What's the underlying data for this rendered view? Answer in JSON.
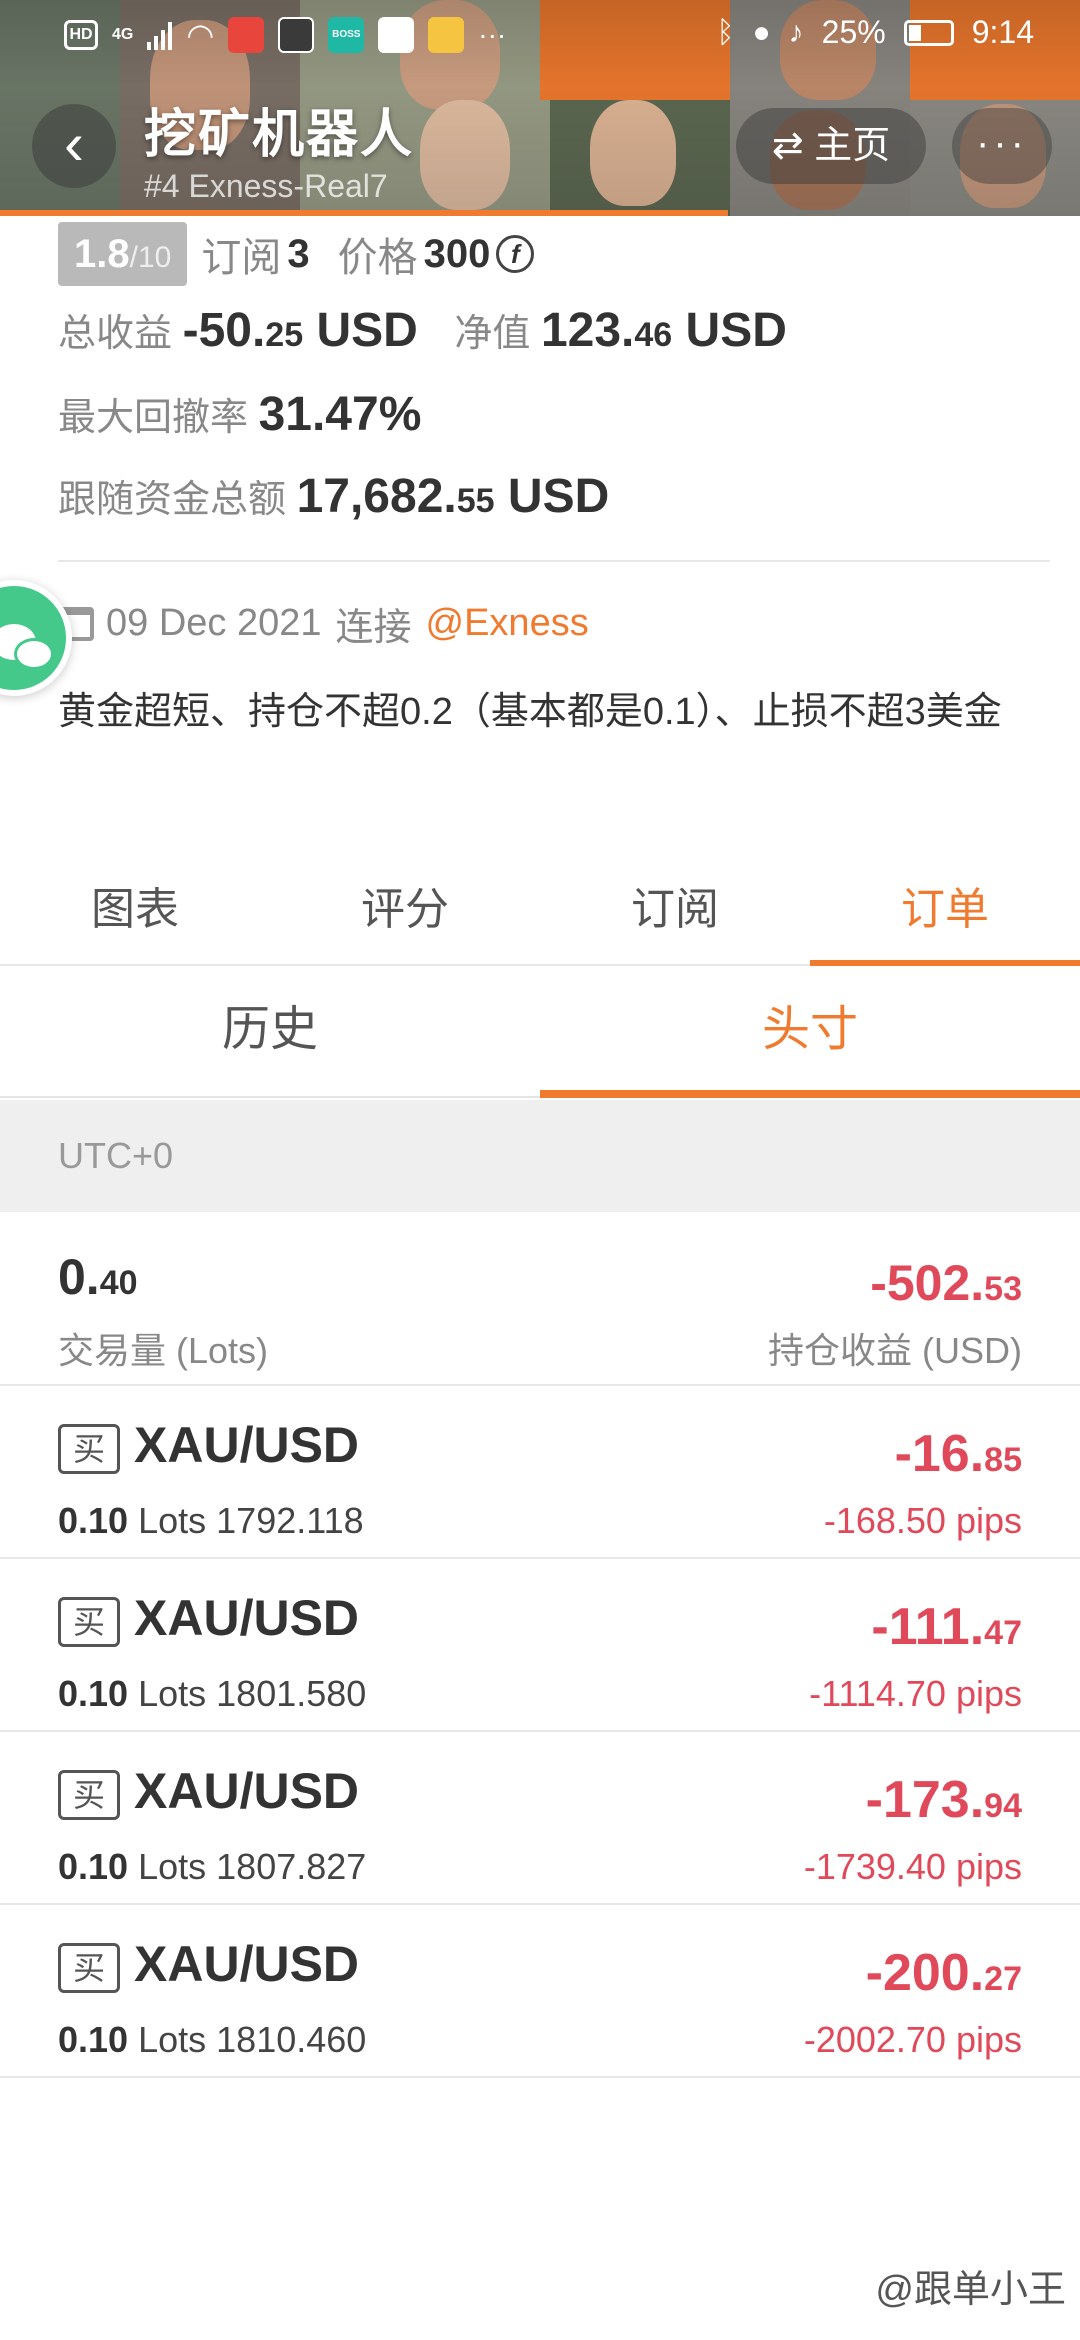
{
  "status_bar": {
    "network": "4G",
    "more": "···",
    "battery": "25%",
    "time": "9:14"
  },
  "header": {
    "title": "挖矿机器人",
    "subtitle": "#4   Exness-Real7",
    "back_icon": "chevron-left-icon",
    "home_label": "主页",
    "more_label": "···"
  },
  "stats": {
    "rating_value": "1.8",
    "rating_denominator": "/10",
    "subscriptions_label": "订阅",
    "subscriptions_value": "3",
    "price_label": "价格",
    "price_value": "300",
    "price_unit_symbol": "f",
    "total_profit_label": "总收益",
    "total_profit_int": "-50.",
    "total_profit_dec": "25",
    "total_profit_unit": "USD",
    "equity_label": "净值",
    "equity_int": "123.",
    "equity_dec": "46",
    "equity_unit": "USD",
    "max_drawdown_label": "最大回撤率",
    "max_drawdown_value": "31.47%",
    "follow_funds_label": "跟随资金总额",
    "follow_funds_int": "17,682.",
    "follow_funds_dec": "55",
    "follow_funds_unit": "USD"
  },
  "connection": {
    "date": "09 Dec 2021",
    "connect_label": "连接",
    "broker": "@Exness",
    "description": "黄金超短、持仓不超0.2（基本都是0.1）、止损不超3美金"
  },
  "tabs": [
    "图表",
    "评分",
    "订阅",
    "订单"
  ],
  "active_tab": "订单",
  "subtabs": [
    "历史",
    "头寸"
  ],
  "active_subtab": "头寸",
  "timezone": "UTC+0",
  "summary": {
    "volume_int": "0.",
    "volume_dec": "40",
    "volume_label": "交易量 (Lots)",
    "pl_int": "-502.",
    "pl_dec": "53",
    "pl_label": "持仓收益 (USD)"
  },
  "positions": [
    {
      "side": "买",
      "symbol": "XAU/USD",
      "lots": "0.10",
      "lots_unit": "Lots",
      "price": "1792.118",
      "pl_int": "-16.",
      "pl_dec": "85",
      "pips": "-168.50 pips"
    },
    {
      "side": "买",
      "symbol": "XAU/USD",
      "lots": "0.10",
      "lots_unit": "Lots",
      "price": "1801.580",
      "pl_int": "-111.",
      "pl_dec": "47",
      "pips": "-1114.70 pips"
    },
    {
      "side": "买",
      "symbol": "XAU/USD",
      "lots": "0.10",
      "lots_unit": "Lots",
      "price": "1807.827",
      "pl_int": "-173.",
      "pl_dec": "94",
      "pips": "-1739.40 pips"
    },
    {
      "side": "买",
      "symbol": "XAU/USD",
      "lots": "0.10",
      "lots_unit": "Lots",
      "price": "1810.460",
      "pl_int": "-200.",
      "pl_dec": "27",
      "pips": "-2002.70 pips"
    }
  ],
  "watermark": "@跟单小王",
  "colors": {
    "accent": "#f07a2e",
    "loss": "#e0495a",
    "wechat": "#44c98b"
  }
}
